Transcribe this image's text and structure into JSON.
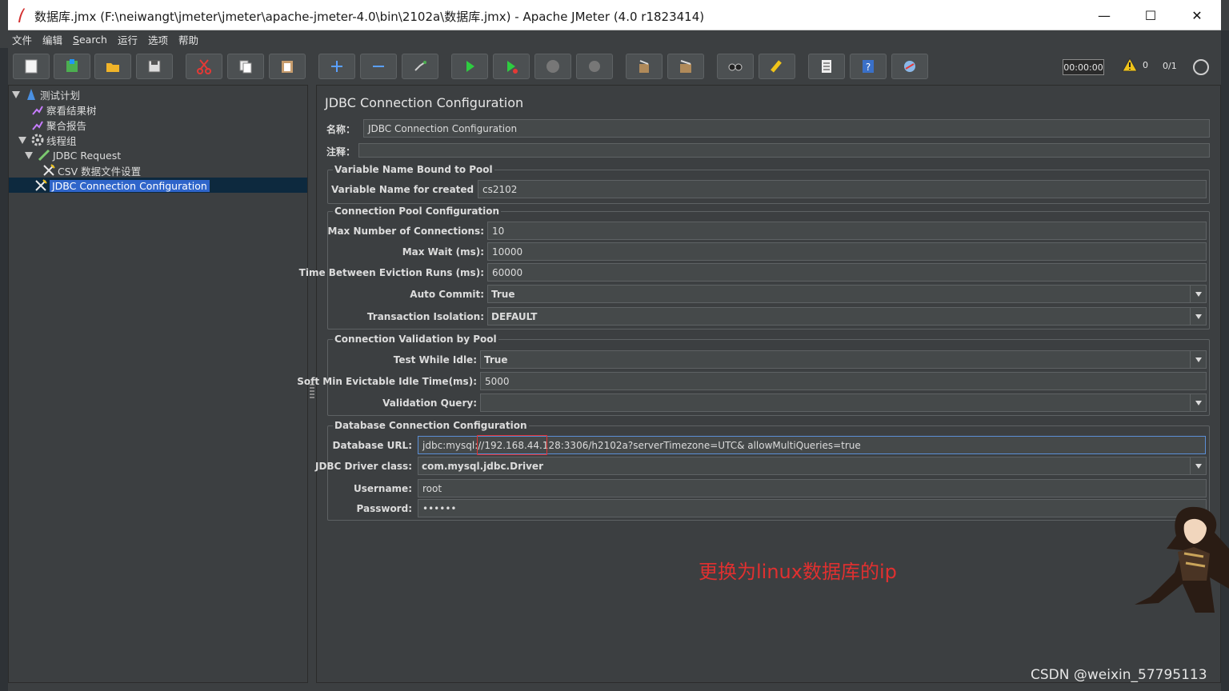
{
  "window": {
    "title": "数据库.jmx (F:\\neiwangt\\jmeter\\jmeter\\apache-jmeter-4.0\\bin\\2102a\\数据库.jmx) - Apache JMeter (4.0 r1823414)",
    "minimize": "—",
    "maximize": "☐",
    "close": "✕"
  },
  "menu": [
    "文件",
    "编辑",
    "Search",
    "运行",
    "选项",
    "帮助"
  ],
  "toolbar": {
    "icons": [
      "new-icon",
      "templates-icon",
      "open-icon",
      "save-icon",
      "cut-icon",
      "copy-icon",
      "paste-icon",
      "expand-icon",
      "collapse-icon",
      "toggle-icon",
      "start-icon",
      "start-no-pause-icon",
      "stop-icon",
      "shutdown-icon",
      "clear-icon",
      "clear-all-icon",
      "search-icon",
      "reset-search-icon",
      "function-helper-icon",
      "help-icon",
      "remote-icon"
    ],
    "timer": "00:00:00",
    "warnings": "0",
    "threads": "0/1"
  },
  "tree": {
    "items": [
      {
        "label": "测试计划",
        "icon": "test-plan-icon"
      },
      {
        "label": "察看结果树",
        "icon": "listener-icon"
      },
      {
        "label": "聚合报告",
        "icon": "listener-icon"
      },
      {
        "label": "线程组",
        "icon": "thread-group-icon"
      },
      {
        "label": "JDBC Request",
        "icon": "sampler-icon"
      },
      {
        "label": "CSV 数据文件设置",
        "icon": "config-element-icon"
      },
      {
        "label": "JDBC Connection Configuration",
        "icon": "config-element-icon"
      }
    ]
  },
  "panel": {
    "title": "JDBC Connection Configuration",
    "name_label": "名称：",
    "name_value": "JDBC Connection Configuration",
    "comment_label": "注释：",
    "comment_value": "",
    "pool_group": {
      "title": "Variable Name Bound to Pool",
      "var_label": "Variable Name for created pool:",
      "var_value": "cs2102"
    },
    "conn_pool": {
      "title": "Connection Pool Configuration",
      "max_conn_label": "Max Number of Connections:",
      "max_conn_value": "10",
      "max_wait_label": "Max Wait (ms):",
      "max_wait_value": "10000",
      "eviction_label": "Time Between Eviction Runs (ms):",
      "eviction_value": "60000",
      "auto_commit_label": "Auto Commit:",
      "auto_commit_value": "True",
      "isolation_label": "Transaction Isolation:",
      "isolation_value": "DEFAULT"
    },
    "validation": {
      "title": "Connection Validation by Pool",
      "test_idle_label": "Test While Idle:",
      "test_idle_value": "True",
      "soft_min_label": "Soft Min Evictable Idle Time(ms):",
      "soft_min_value": "5000",
      "query_label": "Validation Query:",
      "query_value": ""
    },
    "db_conn": {
      "title": "Database Connection Configuration",
      "url_label": "Database URL:",
      "url_value": "jdbc:mysql://192.168.44.128:3306/h2102a?serverTimezone=UTC& allowMultiQueries=true",
      "driver_label": "JDBC Driver class:",
      "driver_value": "com.mysql.jdbc.Driver",
      "user_label": "Username:",
      "user_value": "root",
      "pass_label": "Password:",
      "pass_value": "••••••"
    }
  },
  "annotation": "更换为linux数据库的ip",
  "watermark": "CSDN @weixin_57795113"
}
